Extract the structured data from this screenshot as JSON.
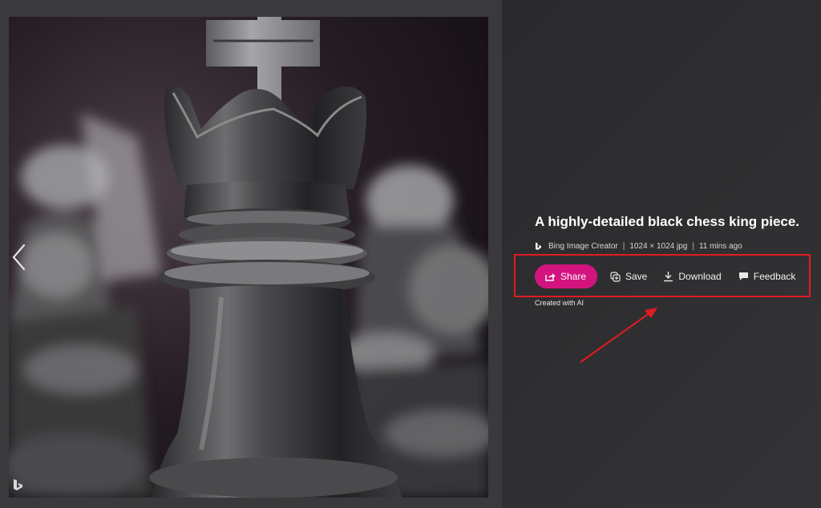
{
  "image": {
    "subject": "black chess king piece"
  },
  "navigation": {
    "prev_icon": "chevron-left-icon"
  },
  "details": {
    "title": "A highly-detailed black chess king piece.",
    "source_label": "Bing Image Creator",
    "dimensions_label": "1024 × 1024 jpg",
    "time_label": "11 mins ago",
    "separator": "|",
    "created_note": "Created with AI"
  },
  "actions": {
    "share_label": "Share",
    "save_label": "Save",
    "download_label": "Download",
    "feedback_label": "Feedback"
  },
  "colors": {
    "share_button": "#d3147e",
    "highlight": "#e11b22",
    "text": "#ffffff",
    "background": "#2b2b2d"
  }
}
